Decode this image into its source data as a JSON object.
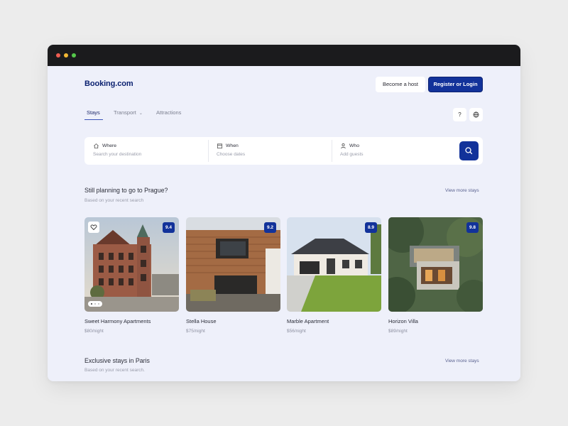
{
  "header": {
    "logo": "Booking.com",
    "become_host": "Become a host",
    "register_login": "Register or Login"
  },
  "tabs": [
    {
      "label": "Stays",
      "active": true
    },
    {
      "label": "Transport",
      "active": false
    },
    {
      "label": "Attractions",
      "active": false
    }
  ],
  "utility_icons": [
    "help-icon",
    "globe-icon"
  ],
  "help_glyph": "?",
  "search": {
    "where": {
      "label": "Where",
      "placeholder": "Search your destination",
      "icon": "home-icon"
    },
    "when": {
      "label": "When",
      "placeholder": "Choose dates",
      "icon": "calendar-icon"
    },
    "who": {
      "label": "Who",
      "placeholder": "Add guests",
      "icon": "user-icon"
    },
    "button_icon": "search-icon"
  },
  "section1": {
    "title": "Still planning to go to Prague?",
    "subtitle": "Based on your recent search",
    "view_more": "View more stays",
    "cards": [
      {
        "name": "Sweet Harmony Apartments",
        "price": "$80/night",
        "rating": "9.4"
      },
      {
        "name": "Stella House",
        "price": "$75/night",
        "rating": "9.2"
      },
      {
        "name": "Marble Apartment",
        "price": "$56/night",
        "rating": "8.9"
      },
      {
        "name": "Horizon Villa",
        "price": "$89/night",
        "rating": "9.8"
      }
    ]
  },
  "section2": {
    "title": "Exclusive stays in Paris",
    "subtitle": "Based on your recent search.",
    "view_more": "View more stays"
  },
  "colors": {
    "brand": "#12329a",
    "logo": "#0b2170",
    "background": "#eef0fa"
  }
}
